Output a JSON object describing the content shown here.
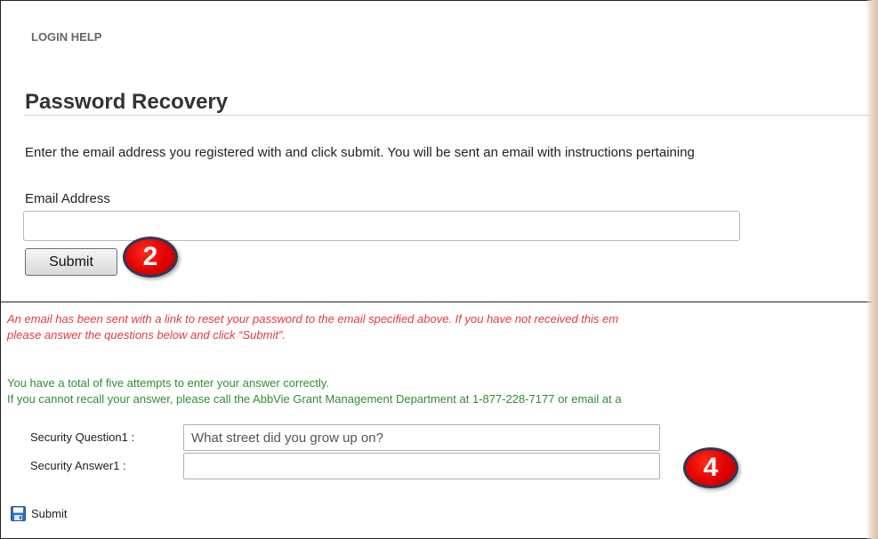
{
  "header": {
    "login_help": "LOGIN HELP"
  },
  "recovery": {
    "title": "Password Recovery",
    "instructions": "Enter the email address you registered with and click submit. You will be sent an email with instructions pertaining",
    "email_label": "Email Address",
    "email_value": "",
    "submit_label": "Submit"
  },
  "callouts": {
    "step_2": "2",
    "step_4": "4"
  },
  "security": {
    "notice_line1": "An email has been sent with a link to reset your password to the email specified above. If you have not received this em",
    "notice_line2": "please answer the questions below and click “Submit”.",
    "attempts_line1": "You have a total of five attempts to enter your answer correctly.",
    "attempts_line2": "If you cannot recall your answer, please call the AbbVie Grant Management Department at 1-877-228-7177 or email at a",
    "question_label": "Security Question1 :",
    "question_value": "What street did you grow up on?",
    "answer_label": "Security Answer1 :",
    "answer_value": "",
    "submit_label": "Submit",
    "submit_icon": "save-icon"
  },
  "colors": {
    "notice": "#e23a3a",
    "attempts": "#2f8f2f",
    "callout_fill": "#e00000",
    "callout_border": "#2b3a55"
  }
}
